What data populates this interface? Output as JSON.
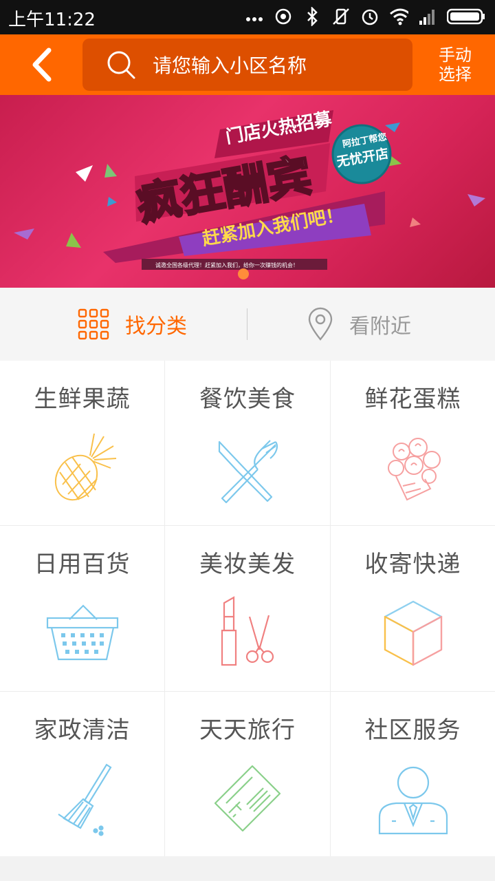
{
  "status_bar": {
    "time": "上午11:22"
  },
  "header": {
    "search_placeholder": "请您输入小区名称",
    "manual_select_line1": "手动",
    "manual_select_line2": "选择"
  },
  "banner": {
    "tag_text": "门店火热招募",
    "headline": "疯狂酬宾",
    "badge_line1": "阿拉丁帮您",
    "badge_line2": "无忧开店",
    "join_text": "赶紧加入我们吧！",
    "fine_print": "诚邀全国各级代理！赶紧加入我们，给你一次赚钱的机会！"
  },
  "tabs": [
    {
      "label": "找分类",
      "icon": "grid-icon",
      "active": true
    },
    {
      "label": "看附近",
      "icon": "location-pin-icon",
      "active": false
    }
  ],
  "categories": [
    {
      "label": "生鲜果蔬",
      "icon": "pineapple-icon",
      "color": "#f9c04a"
    },
    {
      "label": "餐饮美食",
      "icon": "fork-knife-icon",
      "color": "#7cc8ec"
    },
    {
      "label": "鲜花蛋糕",
      "icon": "flower-bouquet-icon",
      "color": "#f6a0a0"
    },
    {
      "label": "日用百货",
      "icon": "basket-icon",
      "color": "#7cc8ec"
    },
    {
      "label": "美妆美发",
      "icon": "lipstick-scissors-icon",
      "color": "#f08080"
    },
    {
      "label": "收寄快递",
      "icon": "package-box-icon",
      "color": "#8fd0ef"
    },
    {
      "label": "家政清洁",
      "icon": "broom-icon",
      "color": "#7cc8ec"
    },
    {
      "label": "天天旅行",
      "icon": "ticket-icon",
      "color": "#8ad08a"
    },
    {
      "label": "社区服务",
      "icon": "person-icon",
      "color": "#7cc8ec"
    }
  ],
  "colors": {
    "brand_orange": "#ff6700",
    "search_bg": "#dd4f00",
    "active_tab": "#ff6700",
    "inactive_tab": "#999999"
  }
}
